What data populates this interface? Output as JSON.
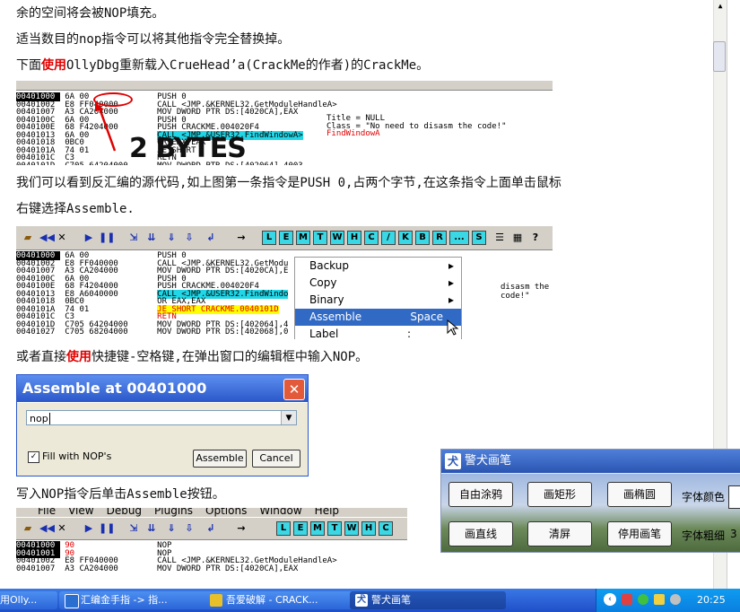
{
  "article": {
    "line1": "余的空间将会被NOP填充。",
    "line2": "适当数目的nop指令可以将其他指令完全替换掉。",
    "line3_pre": "下面",
    "line3_red": "使用",
    "line3_post": "OllyDbg重新载入CrueHead’a(CrackMe的作者)的CrackMe。",
    "line4": "我们可以看到反汇编的源代码,如上图第一条指令是PUSH 0,占两个字节,在这条指令上面单击鼠标",
    "line5": "右键选择Assemble.",
    "line6_pre": "或者直接",
    "line6_red": "使用",
    "line6_post": "快捷键-空格键,在弹出窗口的编辑框中输入NOP。",
    "line7": "写入NOP指令后单击Assemble按钮。"
  },
  "shot1": {
    "annotation": "2 BYTES",
    "rows": [
      {
        "addr": "00401000",
        "hex": "6A 00",
        "asm": "PUSH 0"
      },
      {
        "addr": "00401002",
        "hex": "E8 FF040000",
        "asm": "CALL <JMP.&KERNEL32.GetModuleHandleA>"
      },
      {
        "addr": "00401007",
        "hex": "A3 CA204000",
        "asm": "MOV DWORD PTR DS:[4020CA],EAX"
      },
      {
        "addr": "0040100C",
        "hex": "6A 00",
        "asm": "PUSH 0"
      },
      {
        "addr": "0040100E",
        "hex": "68 F4204000",
        "asm": "PUSH CRACKME.004020F4"
      },
      {
        "addr": "00401013",
        "hex": "6A 00",
        "asm": "CALL <JMP.&USER32.FindWindowA>"
      },
      {
        "addr": "00401018",
        "hex": "0BC0",
        "asm": "OR EAX,EAX"
      },
      {
        "addr": "0040101A",
        "hex": "74 01",
        "asm": "JE SHORT"
      },
      {
        "addr": "0040101C",
        "hex": "C3",
        "asm": "RETN"
      },
      {
        "addr": "0040101D",
        "hex": "C705 64204000",
        "asm": "MOV DWORD PTR DS:[402064],4003"
      }
    ],
    "comments": [
      "Title = NULL",
      "Class = \"No need to disasm the code!\"",
      "FindWindowA"
    ]
  },
  "toolbar_letters": [
    "L",
    "E",
    "M",
    "T",
    "W",
    "H",
    "C",
    "/",
    "K",
    "B",
    "R",
    "...",
    "S"
  ],
  "shot2": {
    "rows": [
      {
        "addr": "00401000",
        "hex": "6A 00",
        "asm": "PUSH 0"
      },
      {
        "addr": "00401002",
        "hex": "E8 FF040000",
        "asm": "CALL <JMP.&KERNEL32.GetModu"
      },
      {
        "addr": "00401007",
        "hex": "A3 CA204000",
        "asm": "MOV DWORD PTR DS:[4020CA],E"
      },
      {
        "addr": "0040100C",
        "hex": "6A 00",
        "asm": "PUSH 0"
      },
      {
        "addr": "0040100E",
        "hex": "68 F4204000",
        "asm": "PUSH CRACKME.004020F4"
      },
      {
        "addr": "00401013",
        "hex": "E8 A6040000",
        "asm": "CALL <JMP.&USER32.FindWindo"
      },
      {
        "addr": "00401018",
        "hex": "0BC0",
        "asm": "OR EAX,EAX"
      },
      {
        "addr": "0040101A",
        "hex": "74 01",
        "asm": "JE SHORT CRACKME.0040101D"
      },
      {
        "addr": "0040101C",
        "hex": "C3",
        "asm": "RETN"
      },
      {
        "addr": "0040101D",
        "hex": "C705 64204000",
        "asm": "MOV DWORD PTR DS:[402064],4"
      },
      {
        "addr": "00401027",
        "hex": "C705 68204000",
        "asm": "MOV DWORD PTR DS:[402068],0"
      }
    ],
    "menu": [
      {
        "label": "Backup",
        "hint": "▸"
      },
      {
        "label": "Copy",
        "hint": "▸"
      },
      {
        "label": "Binary",
        "hint": "▸"
      },
      {
        "label": "Assemble",
        "hint": "Space"
      },
      {
        "label": "Label",
        "hint": ":"
      }
    ],
    "comment": "disasm the code!\""
  },
  "dialog": {
    "title": "Assemble at 00401000",
    "input": "nop",
    "checkbox": "Fill with NOP's",
    "assemble": "Assemble",
    "cancel": "Cancel"
  },
  "shot3": {
    "menubar": [
      "File",
      "View",
      "Debug",
      "Plugins",
      "Options",
      "Window",
      "Help"
    ],
    "rows": [
      {
        "addr": "00401000",
        "hex": "90",
        "asm": "NOP"
      },
      {
        "addr": "00401001",
        "hex": "90",
        "asm": "NOP"
      },
      {
        "addr": "00401002",
        "hex": "E8 FF040000",
        "asm": "CALL <JMP.&KERNEL32.GetModuleHandleA>"
      },
      {
        "addr": "00401007",
        "hex": "A3 CA204000",
        "asm": "MOV DWORD PTR DS:[4020CA],EAX"
      }
    ]
  },
  "jingquan": {
    "title": "警犬画笔",
    "buttons": [
      "自由涂鸦",
      "画矩形",
      "画椭圆",
      "画直线",
      "清屏",
      "停用画笔"
    ],
    "label_color": "字体颜色",
    "label_weight": "字体粗细",
    "weight_value": "3"
  },
  "taskbar": {
    "items": [
      "用Olly...",
      "汇编金手指 -> 指...",
      "吾爱破解 - CRACK...",
      "警犬画笔"
    ],
    "clock": "20:25"
  }
}
